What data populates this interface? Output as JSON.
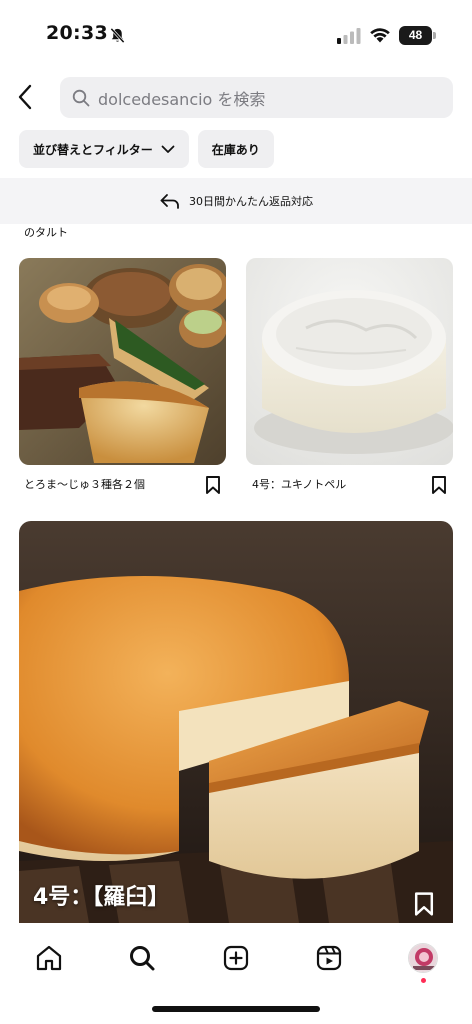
{
  "status_bar": {
    "time": "20:33",
    "battery": "48"
  },
  "search": {
    "placeholder": "dolcedesancio を検索"
  },
  "filters": {
    "sort_filter_label": "並び替えとフィルター",
    "in_stock_label": "在庫あり"
  },
  "returns_banner": {
    "text": "30日間かんたん返品対応"
  },
  "partial_caption": "のタルト",
  "products": [
    {
      "title": "とろま〜じゅ３種各２個"
    },
    {
      "title": "4号：ユキノトペル"
    },
    {
      "title": "4号：【羅臼】"
    }
  ],
  "colors": {
    "accent_notification": "#ff2d55",
    "chip_bg": "#efeff1",
    "banner_bg": "#f4f4f6"
  },
  "icons": {
    "status": [
      "bell-slash-icon",
      "signal-icon",
      "wifi-icon",
      "battery-icon"
    ],
    "nav": [
      "home-icon",
      "search-icon",
      "create-icon",
      "reels-icon",
      "profile-avatar"
    ]
  }
}
